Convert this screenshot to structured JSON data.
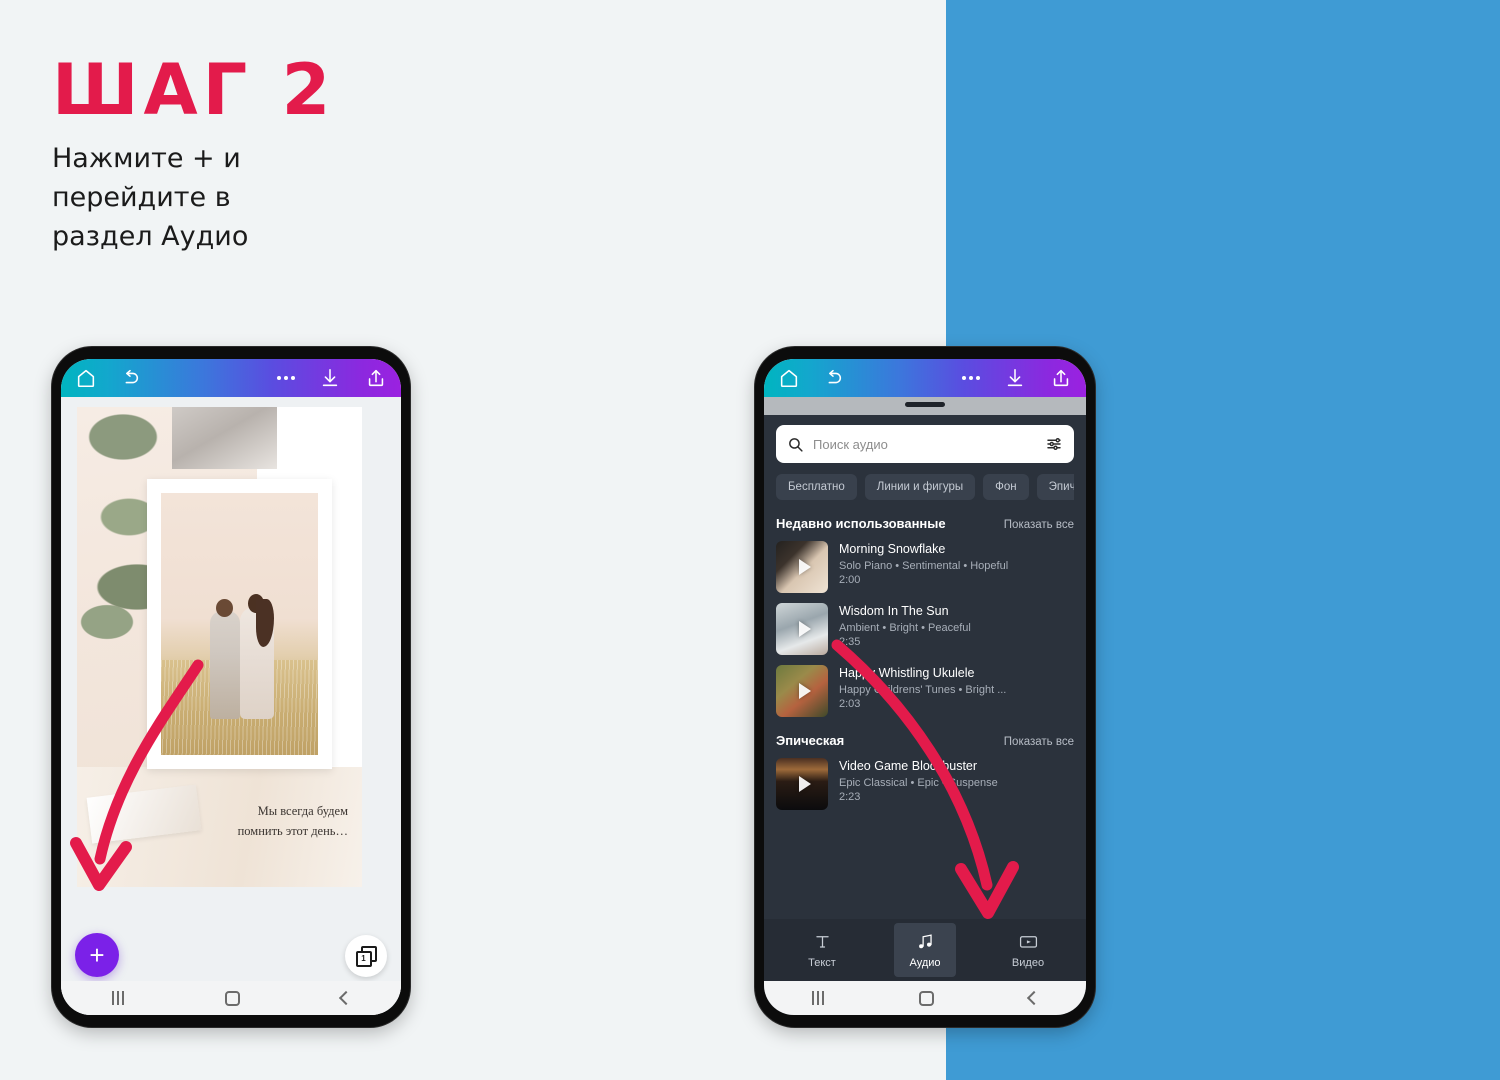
{
  "theme": {
    "page_bg": "#f1f4f5",
    "blue_panel": "#3f9bd4",
    "accent_red": "#e31b4b",
    "fab_purple": "#7b21e8",
    "panel_dark": "#2b323c"
  },
  "headline": {
    "step": "ШАГ 2",
    "instruction": "Нажмите + и\nперейдите в\nраздел Аудио"
  },
  "phone_left": {
    "topbar": {
      "home": "home-icon",
      "undo": "undo-icon",
      "more": "more-icon",
      "download": "download-icon",
      "share": "share-icon"
    },
    "canvas": {
      "caption": "Мы всегда будем\nпомнить этот день…"
    },
    "add_button_label": "+",
    "pages_count": "1",
    "nav": {
      "recents": "recents-icon",
      "home": "home-icon",
      "back": "back-icon"
    }
  },
  "phone_right": {
    "topbar": {
      "home": "home-icon",
      "undo": "undo-icon",
      "more": "more-icon",
      "download": "download-icon",
      "share": "share-icon"
    },
    "search": {
      "placeholder": "Поиск аудио",
      "value": "",
      "filter_icon": "sliders-icon",
      "search_icon": "search-icon"
    },
    "chips": [
      "Бесплатно",
      "Линии и фигуры",
      "Фон",
      "Эпичес"
    ],
    "sections": [
      {
        "title": "Недавно использованные",
        "see_all": "Показать все",
        "tracks": [
          {
            "name": "Morning Snowflake",
            "meta": "Solo Piano • Sentimental • Hopeful",
            "duration": "2:00"
          },
          {
            "name": "Wisdom In The Sun",
            "meta": "Ambient • Bright • Peaceful",
            "duration": "2:35"
          },
          {
            "name": "Happy Whistling Ukulele",
            "meta": "Happy Childrens' Tunes • Bright ...",
            "duration": "2:03"
          }
        ]
      },
      {
        "title": "Эпическая",
        "see_all": "Показать все",
        "tracks": [
          {
            "name": "Video Game Blockbuster",
            "meta": "Epic Classical • Epic • Suspense",
            "duration": "2:23"
          }
        ]
      }
    ],
    "tabbar": [
      {
        "label": "Текст",
        "icon": "text-icon",
        "active": false
      },
      {
        "label": "Аудио",
        "icon": "music-note-icon",
        "active": true
      },
      {
        "label": "Видео",
        "icon": "video-icon",
        "active": false
      }
    ],
    "nav": {
      "recents": "recents-icon",
      "home": "home-icon",
      "back": "back-icon"
    }
  }
}
